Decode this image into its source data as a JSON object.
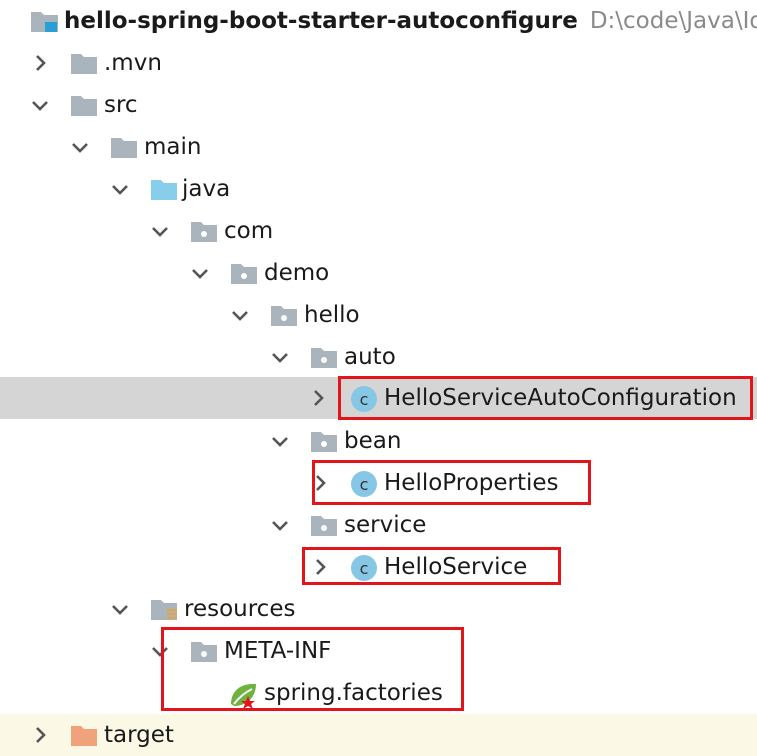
{
  "project": {
    "name": "hello-spring-boot-starter-autoconfigure",
    "path": "D:\\code\\Java\\Ide"
  },
  "tree": {
    "mvn": ".mvn",
    "src": "src",
    "main": "main",
    "java": "java",
    "com": "com",
    "demo": "demo",
    "hello": "hello",
    "auto": "auto",
    "auto_config_class": "HelloServiceAutoConfiguration",
    "bean": "bean",
    "properties_class": "HelloProperties",
    "service": "service",
    "service_class": "HelloService",
    "resources": "resources",
    "meta_inf": "META-INF",
    "factories": "spring.factories",
    "target": "target"
  },
  "colors": {
    "folder": "#aab4bc",
    "java_folder": "#87ceeb",
    "class_icon": "#87c7e6",
    "highlight": "#e3141a",
    "selected_row": "#d5d5d5"
  }
}
